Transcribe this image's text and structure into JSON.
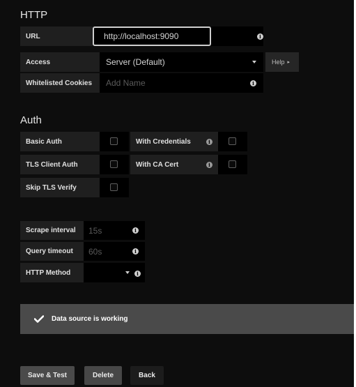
{
  "http": {
    "title": "HTTP",
    "url_label": "URL",
    "url_value": "http://localhost:9090",
    "access_label": "Access",
    "access_value": "Server (Default)",
    "help_label": "Help",
    "cookies_label": "Whitelisted Cookies",
    "cookies_placeholder": "Add Name"
  },
  "auth": {
    "title": "Auth",
    "basic_auth_label": "Basic Auth",
    "with_credentials_label": "With Credentials",
    "tls_client_auth_label": "TLS Client Auth",
    "with_ca_cert_label": "With CA Cert",
    "skip_tls_label": "Skip TLS Verify"
  },
  "prometheus": {
    "scrape_label": "Scrape interval",
    "scrape_placeholder": "15s",
    "query_label": "Query timeout",
    "query_placeholder": "60s",
    "method_label": "HTTP Method",
    "method_value": ""
  },
  "status": {
    "message": "Data source is working",
    "color": "#4a4a4a"
  },
  "buttons": {
    "save_test": "Save & Test",
    "delete": "Delete",
    "back": "Back"
  }
}
